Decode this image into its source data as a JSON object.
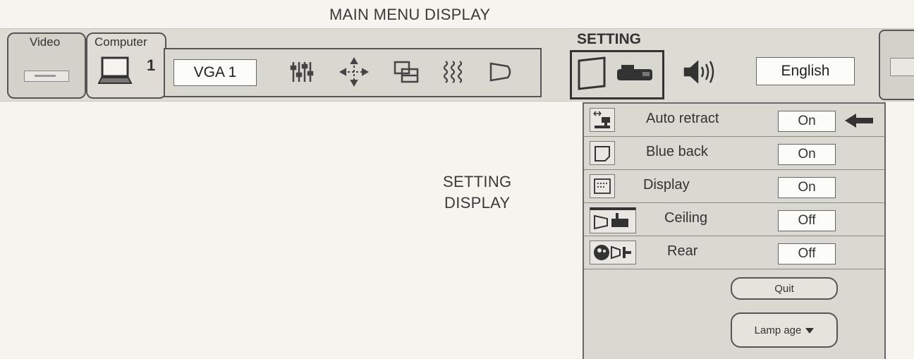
{
  "captions": {
    "main_menu": "MAIN MENU DISPLAY",
    "setting_display_line1": "SETTING",
    "setting_display_line2": "DISPLAY"
  },
  "menubar": {
    "video_tab": "Video",
    "computer_tab": "Computer",
    "computer_number": "1",
    "input_source": "VGA 1",
    "setting_label": "SETTING",
    "language": "English"
  },
  "setting_panel": {
    "rows": [
      {
        "label": "Auto retract",
        "value": "On",
        "icon": "auto-retract-icon"
      },
      {
        "label": "Blue back",
        "value": "On",
        "icon": "blue-back-icon"
      },
      {
        "label": "Display",
        "value": "On",
        "icon": "display-icon"
      },
      {
        "label": "Ceiling",
        "value": "Off",
        "icon": "ceiling-icon"
      },
      {
        "label": "Rear",
        "value": "Off",
        "icon": "rear-icon"
      }
    ],
    "quit_label": "Quit",
    "lamp_age_label": "Lamp age"
  },
  "colors": {
    "background": "#f5f4ef",
    "bar": "#dcdbd4",
    "panel": "#d9d8d1",
    "outline": "#555555"
  }
}
